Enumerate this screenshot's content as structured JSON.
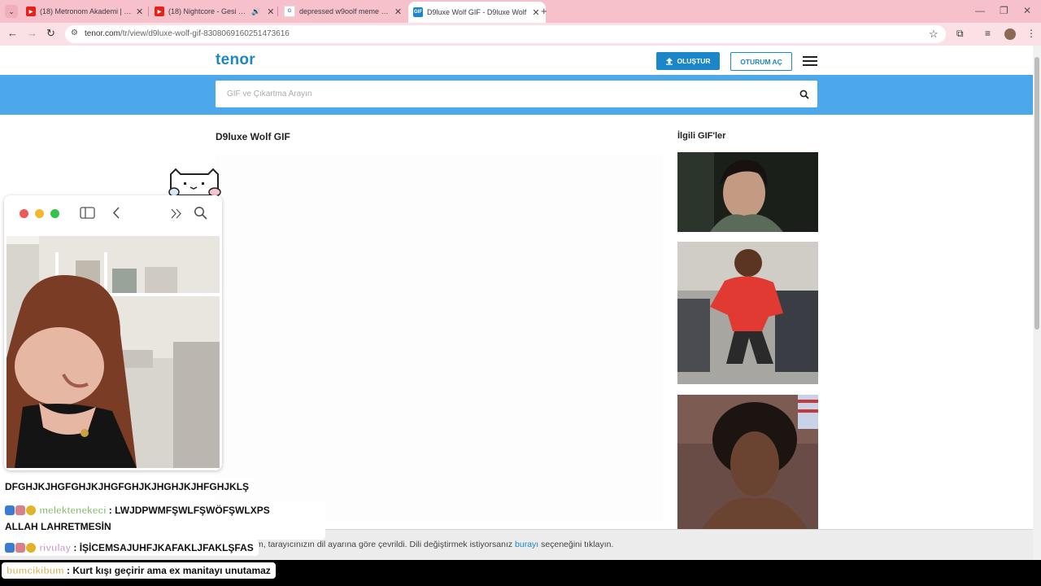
{
  "browser": {
    "tabs": [
      {
        "title": "(18) Metronom Akademi | 7. Böl",
        "active": false
      },
      {
        "title": "(18) Nightcore - Gesi Bağları",
        "active": false
      },
      {
        "title": "depressed w9oolf meme - Goo",
        "active": false
      },
      {
        "title": "D9luxe Wolf GIF - D9luxe Wolf",
        "active": true
      }
    ],
    "new_tab": "+",
    "url_host": "tenor.com",
    "url_path": "/tr/view/d9luxe-wolf-gif-8308069160251473616"
  },
  "tenor": {
    "logo": "tenor",
    "create_label": "OLUŞTUR",
    "login_label": "OTURUM AÇ",
    "search_placeholder": "GIF ve Çıkartma Arayın",
    "gif_title": "D9luxe Wolf GIF",
    "related_title": "İlgili GIF'ler",
    "notice_prefix": "m, tarayıcınızın dil ayarına göre çevrildi. Dili değiştirmek istiyorsanız ",
    "notice_link": "burayı",
    "notice_suffix": " seçeneğini tıklayın."
  },
  "chat": {
    "line1": "DFGHJKJHGFGHJKJHGFGHJKJHGHJKJHFGHJKLŞ",
    "line2_user": "melektenekeci",
    "line2_msg": ": LWJDPWMFŞWLFŞWÖFŞWLXPS",
    "line2_cont": "ALLAH LAHRETMESİN",
    "line3_user": "rivulay",
    "line3_msg": ": İŞİCEMSAJUHFJKAFAKLJFAKLŞFAS",
    "line4_user": "bumcikibum",
    "line4_msg": ": Kurt kışı geçirir ama ex manitayı unutamaz"
  },
  "colors": {
    "accent": "#1b87c9",
    "tabstrip": "#f7c1cc",
    "search_band": "#4ca8ea"
  }
}
